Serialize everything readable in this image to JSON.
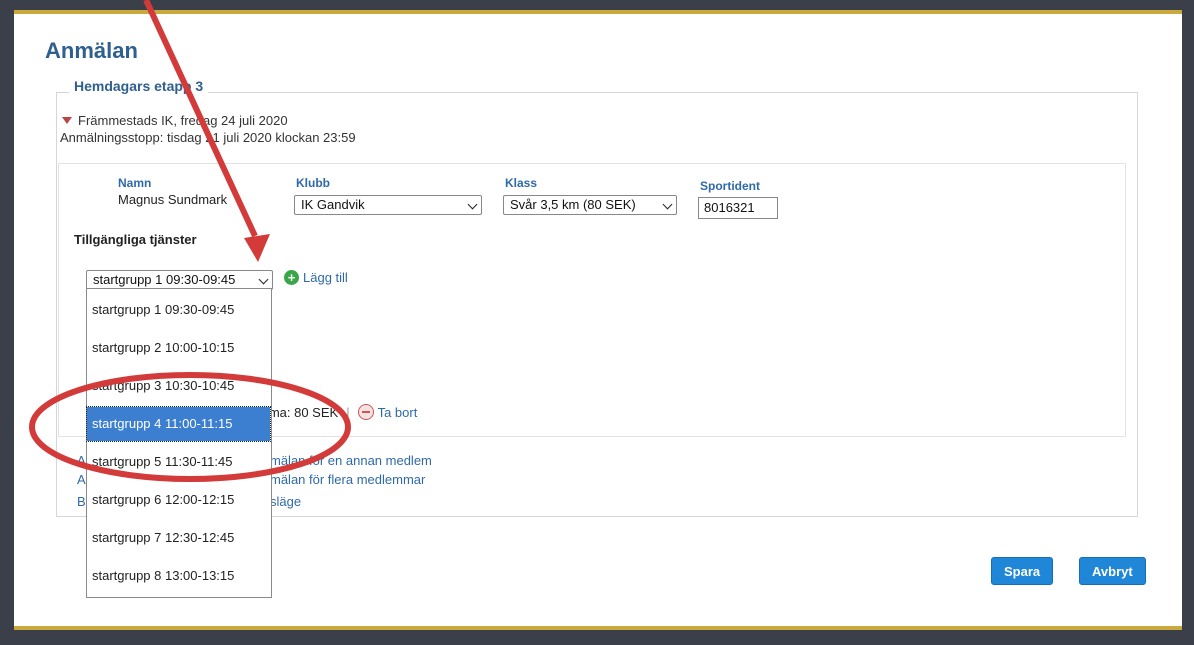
{
  "page": {
    "title": "Anmälan",
    "event_name": "Hemdagars etapp 3",
    "organizer_date": "Främmestads IK, fredag 24 juli 2020",
    "deadline": "Anmälningsstopp: tisdag 21 juli 2020 klockan 23:59"
  },
  "entry": {
    "name_label": "Namn",
    "name_value": "Magnus Sundmark",
    "club_label": "Klubb",
    "club_value": "IK Gandvik",
    "class_label": "Klass",
    "class_value": "Svår 3,5 km (80 SEK)",
    "sportident_label": "Sportident",
    "sportident_value": "8016321"
  },
  "services": {
    "title": "Tillgängliga tjänster",
    "selected": "startgrupp 1 09:30-09:45",
    "add_label": "Lägg till",
    "options": [
      "startgrupp 1 09:30-09:45",
      "startgrupp 2 10:00-10:15",
      "startgrupp 3 10:30-10:45",
      "startgrupp 4 11:00-11:15",
      "startgrupp 5 11:30-11:45",
      "startgrupp 6 12:00-12:15",
      "startgrupp 7 12:30-12:45",
      "startgrupp 8 13:00-13:15"
    ],
    "highlighted_index": 3
  },
  "summary": {
    "sum_text": "mma: 80 SEK",
    "separator": "|",
    "remove_label": "Ta bort"
  },
  "links": {
    "l1_prefix": "A",
    "l1_text": "mälan för en annan medlem",
    "l2_prefix": "A",
    "l2_text": "mälan för flera medlemmar",
    "l3_prefix": "B",
    "l3_text": "släge"
  },
  "buttons": {
    "save": "Spara",
    "cancel": "Avbryt"
  },
  "colors": {
    "annotation": "#d33a3a",
    "accent": "#1f86d8",
    "selection": "#3c7fd0"
  }
}
